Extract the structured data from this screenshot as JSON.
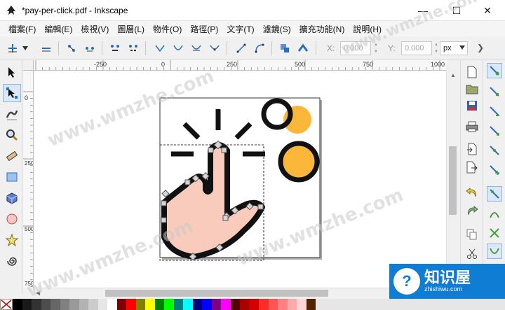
{
  "window": {
    "title": "*pay-per-click.pdf - Inkscape",
    "controls": {
      "minimize": "—",
      "maximize": "☐",
      "close": "✕"
    }
  },
  "menu": [
    {
      "label": "檔案(F)"
    },
    {
      "label": "編輯(E)"
    },
    {
      "label": "檢視(V)"
    },
    {
      "label": "圖層(L)"
    },
    {
      "label": "物件(O)"
    },
    {
      "label": "路徑(P)"
    },
    {
      "label": "文字(T)"
    },
    {
      "label": "濾鏡(S)"
    },
    {
      "label": "擴充功能(N)"
    },
    {
      "label": "說明(H)"
    }
  ],
  "commands": {
    "x_label": "X:",
    "x_value": "0.000",
    "y_label": "Y:",
    "y_value": "0.000",
    "unit": "px",
    "more": "❯"
  },
  "ruler": {
    "h_labels": [
      "-250",
      "0",
      "250",
      "500",
      "750",
      "1000"
    ],
    "v_labels": [
      "0",
      "250",
      "500",
      "750"
    ]
  },
  "tools": [
    {
      "name": "selector-tool",
      "icon": "arrow-icon"
    },
    {
      "name": "node-tool",
      "icon": "node-icon",
      "active": true
    },
    {
      "name": "tweak-tool",
      "icon": "tweak-icon"
    },
    {
      "name": "zoom-tool",
      "icon": "zoom-icon"
    },
    {
      "name": "measure-tool",
      "icon": "ruler-icon"
    },
    {
      "name": "rect-tool",
      "icon": "rect-icon"
    },
    {
      "name": "3dbox-tool",
      "icon": "cube-icon"
    },
    {
      "name": "ellipse-tool",
      "icon": "circle-icon"
    },
    {
      "name": "star-tool",
      "icon": "star-icon"
    },
    {
      "name": "spiral-tool",
      "icon": "spiral-icon"
    }
  ],
  "artwork": {
    "hand_fill": "#f8cbbd",
    "stroke": "#111111",
    "accent": "#fbb73a"
  },
  "palette": [
    "#000000",
    "#1a1a1a",
    "#333333",
    "#4d4d4d",
    "#666666",
    "#808080",
    "#999999",
    "#b3b3b3",
    "#cccccc",
    "#e6e6e6",
    "#ffffff",
    "#800000",
    "#ff0000",
    "#808000",
    "#ffff00",
    "#008000",
    "#00ff00",
    "#008080",
    "#00ffff",
    "#000080",
    "#0000ff",
    "#800080",
    "#ff00ff",
    "#550000",
    "#aa0000",
    "#d40000",
    "#ff2a2a",
    "#ff5555",
    "#ff8080",
    "#ffaaaa",
    "#ffd5d5",
    "#552200"
  ],
  "watermark": {
    "text": "www.wmzhe.com"
  },
  "brand": {
    "name_cn": "知识屋",
    "name_en": "zhishiwu.com",
    "logo": "?"
  }
}
